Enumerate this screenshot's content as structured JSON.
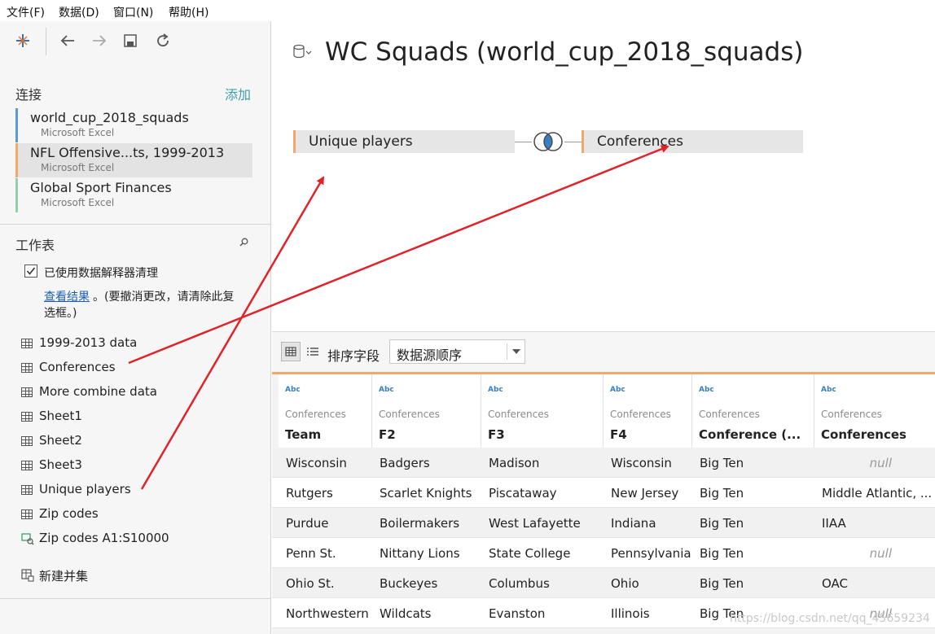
{
  "menu": [
    "文件(F)",
    "数据(D)",
    "窗口(N)",
    "帮助(H)"
  ],
  "connections": {
    "title": "连接",
    "add_label": "添加",
    "items": [
      {
        "name": "world_cup_2018_squads",
        "type": "Microsoft Excel",
        "color": "#5b9bd5"
      },
      {
        "name": "NFL Offensive...ts, 1999-2013",
        "type": "Microsoft Excel",
        "color": "#f0a868"
      },
      {
        "name": "Global Sport Finances",
        "type": "Microsoft Excel",
        "color": "#93cfa8"
      }
    ]
  },
  "sheets_panel": {
    "title": "工作表",
    "interpreter_label": "已使用数据解释器清理",
    "interpreter_checked": true,
    "view_results_link": "查看结果",
    "note_line1": "。(要撤消更改，请清除此复",
    "note_line2": "选框。)",
    "items": [
      "1999-2013 data",
      "Conferences",
      "More combine data",
      "Sheet1",
      "Sheet2",
      "Sheet3",
      "Unique players",
      "Zip codes",
      "Zip codes A1:S10000"
    ],
    "new_union": "新建并集"
  },
  "datasource_title": "WC Squads (world_cup_2018_squads)",
  "join": {
    "left_table": "Unique players",
    "right_table": "Conferences"
  },
  "grid_toolbar": {
    "sort_label": "排序字段",
    "sort_value": "数据源顺序"
  },
  "grid": {
    "columns": [
      {
        "type": "Abc",
        "source": "Conferences",
        "field": "Team"
      },
      {
        "type": "Abc",
        "source": "Conferences",
        "field": "F2"
      },
      {
        "type": "Abc",
        "source": "Conferences",
        "field": "F3"
      },
      {
        "type": "Abc",
        "source": "Conferences",
        "field": "F4"
      },
      {
        "type": "Abc",
        "source": "Conferences",
        "field": "Conference (..."
      },
      {
        "type": "Abc",
        "source": "Conferences",
        "field": "Conferences"
      }
    ],
    "rows": [
      [
        "Wisconsin",
        "Badgers",
        "Madison",
        "Wisconsin",
        "Big Ten",
        "null"
      ],
      [
        "Rutgers",
        "Scarlet Knights",
        "Piscataway",
        "New Jersey",
        "Big Ten",
        "Middle Atlantic, ..."
      ],
      [
        "Purdue",
        "Boilermakers",
        "West Lafayette",
        "Indiana",
        "Big Ten",
        "IIAA"
      ],
      [
        "Penn St.",
        "Nittany Lions",
        "State College",
        "Pennsylvania",
        "Big Ten",
        "null"
      ],
      [
        "Ohio St.",
        "Buckeyes",
        "Columbus",
        "Ohio",
        "Big Ten",
        "OAC"
      ],
      [
        "Northwestern",
        "Wildcats",
        "Evanston",
        "Illinois",
        "Big Ten",
        "null"
      ]
    ]
  },
  "watermark": "https://blog.csdn.net/qq_45659234",
  "colors": {
    "accent_orange": "#f0a868",
    "link_blue": "#1a5fb4",
    "arrow_red": "#e0232a",
    "add_teal": "#3d9eaa"
  }
}
